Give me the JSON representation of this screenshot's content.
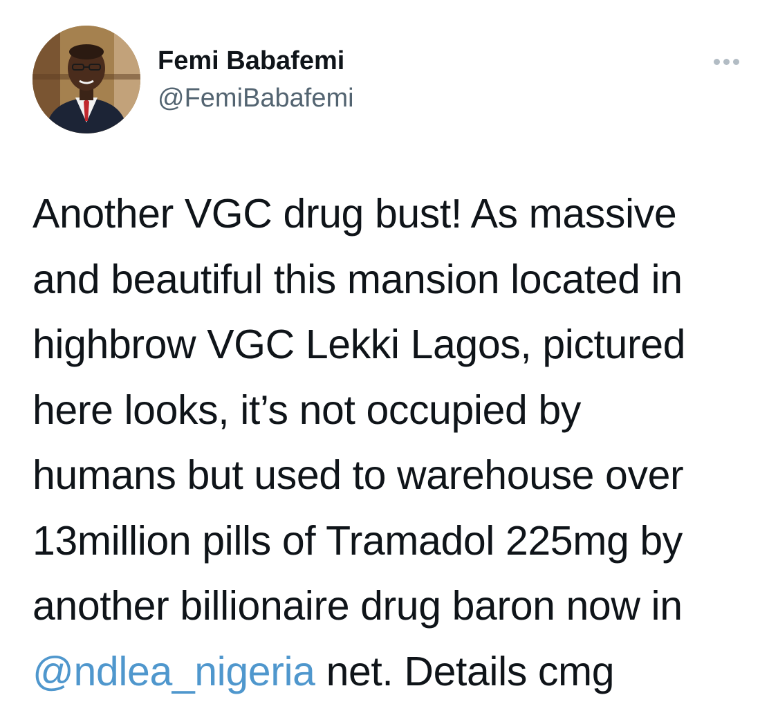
{
  "tweet": {
    "author": {
      "name": "Femi Babafemi",
      "handle": "@FemiBabafemi",
      "avatar_icon": "profile-photo"
    },
    "more_icon": "more-horizontal-icon",
    "text_lines": [
      "Another VGC drug bust! As massive",
      "and beautiful this mansion located in",
      "highbrow VGC Lekki Lagos, pictured",
      "here looks, it’s not occupied by",
      "humans but used to warehouse over",
      "13million pills of Tramadol 225mg by",
      "another billionaire drug baron now in"
    ],
    "last_line": {
      "mention": "@ndlea_nigeria",
      "rest": " net. Details cmg"
    },
    "colors": {
      "text": "#0f1419",
      "handle": "#536471",
      "link": "#4f97cd",
      "more_dots": "#b2bcc4"
    }
  }
}
